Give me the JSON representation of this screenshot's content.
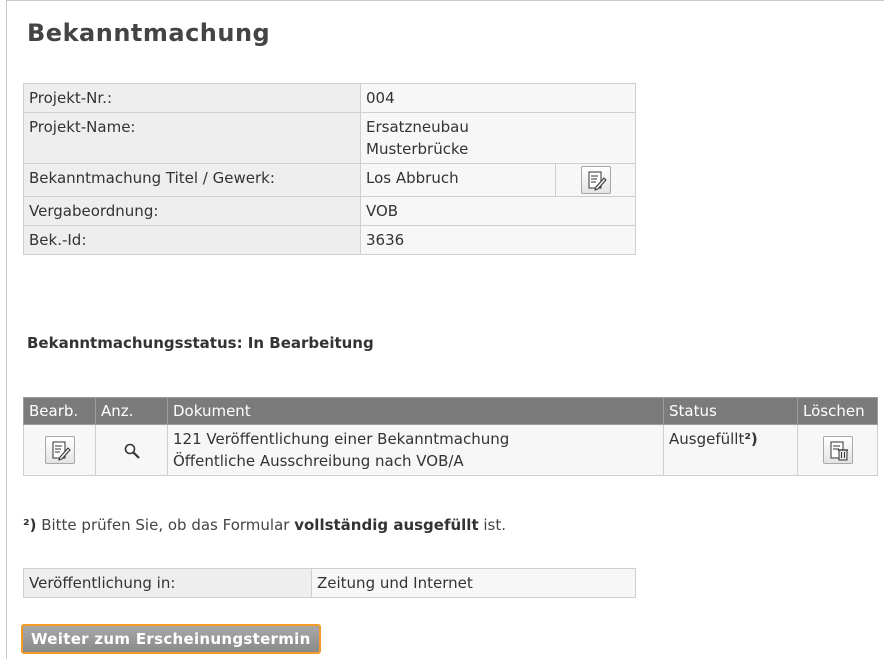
{
  "page": {
    "title": "Bekanntmachung"
  },
  "project_info": {
    "rows": [
      {
        "label": "Projekt-Nr.:",
        "value": "004"
      },
      {
        "label": "Projekt-Name:",
        "value": "Ersatzneubau Musterbrücke"
      },
      {
        "label": "Bekanntmachung Titel / Gewerk:",
        "value": "Los Abbruch",
        "has_edit_button": true,
        "edit_icon": "edit-document-icon"
      },
      {
        "label": "Vergabeordnung:",
        "value": "VOB"
      },
      {
        "label": "Bek.-Id:",
        "value": "3636"
      }
    ]
  },
  "status": {
    "text": "Bekanntmachungsstatus: In Bearbeitung"
  },
  "documents": {
    "columns": [
      "Bearb.",
      "Anz.",
      "Dokument",
      "Status",
      "Löschen"
    ],
    "rows": [
      {
        "edit_icon": "edit-document-icon",
        "view_icon": "magnifier-icon",
        "document_line1": "121 Veröffentlichung einer Bekanntmachung",
        "document_line2": "Öffentliche Ausschreibung nach VOB/A",
        "status": "Ausgefüllt",
        "status_note": "²)",
        "delete_icon": "delete-document-icon"
      }
    ]
  },
  "note": {
    "marker": "²)",
    "text_before": " Bitte prüfen Sie, ob das Formular ",
    "emphasis": "vollständig ausgefüllt",
    "text_after": " ist."
  },
  "publication": {
    "label": "Veröffentlichung in:",
    "value": "Zeitung und Internet"
  },
  "actions": {
    "next_label": "Weiter zum Erscheinungstermin"
  },
  "colors": {
    "header_bg": "#7b7b7b",
    "button_border": "#f39a28",
    "label_bg": "#eeeeee"
  }
}
